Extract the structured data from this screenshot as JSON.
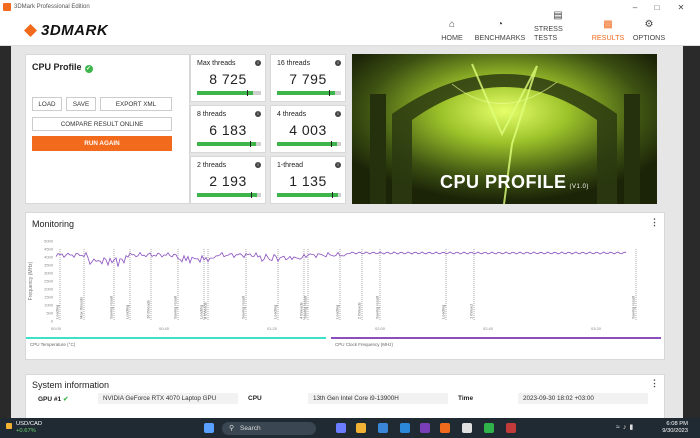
{
  "window": {
    "title": "3DMark Professional Edition"
  },
  "header": {
    "brand": "3DMARK",
    "nav": [
      {
        "label": "HOME",
        "icon": "home-icon"
      },
      {
        "label": "BENCHMARKS",
        "icon": "benchmarks-icon"
      },
      {
        "label": "STRESS TESTS",
        "icon": "stress-tests-icon"
      },
      {
        "label": "RESULTS",
        "icon": "results-icon",
        "active": true
      },
      {
        "label": "OPTIONS",
        "icon": "gear-icon"
      }
    ]
  },
  "profile": {
    "title": "CPU Profile",
    "load": "LOAD",
    "save": "SAVE",
    "export": "EXPORT XML",
    "compare": "COMPARE RESULT ONLINE",
    "run_again": "RUN AGAIN"
  },
  "scores": [
    {
      "label": "Max threads",
      "value": "8 725",
      "level": 0.88
    },
    {
      "label": "16 threads",
      "value": "7 795",
      "level": 0.9
    },
    {
      "label": "8 threads",
      "value": "6 183",
      "level": 0.92
    },
    {
      "label": "4 threads",
      "value": "4 003",
      "level": 0.93
    },
    {
      "label": "2 threads",
      "value": "2 193",
      "level": 0.94
    },
    {
      "label": "1-thread",
      "value": "1 135",
      "level": 0.95
    }
  ],
  "banner": {
    "title": "CPU PROFILE",
    "version": "(V1.0)"
  },
  "monitoring": {
    "title": "Monitoring",
    "ylabel": "Frequency (MHz)",
    "yticks": [
      "5000",
      "4500",
      "4000",
      "3500",
      "3000",
      "2500",
      "2000",
      "1500",
      "1000",
      "500",
      "0"
    ],
    "xticks": [
      "00:00",
      "00:40",
      "01:20",
      "02:00",
      "02:40",
      "03:20"
    ],
    "markers": [
      "Loading",
      "Max threads",
      "Saving result",
      "Loading",
      "16 threads",
      "Saving result",
      "Loading",
      "8 threads",
      "Saving result",
      "Loading",
      "4 threads",
      "Saving result",
      "Loading",
      "2 threads",
      "Saving result",
      "Loading",
      "1 thread",
      "Saving result"
    ],
    "legend": [
      {
        "label": "CPU Temperature (°C)",
        "color": "#3de0c8"
      },
      {
        "label": "CPU Clock Frequency (MHz)",
        "color": "#8a4fbf"
      }
    ],
    "series_color": "#8a4fbf"
  },
  "sysinfo": {
    "title": "System information",
    "gpu_label": "GPU #1",
    "gpu_value": "NVIDIA GeForce RTX 4070 Laptop GPU",
    "cpu_label": "CPU",
    "cpu_value": "13th Gen Intel Core i9-13900H",
    "time_label": "Time",
    "time_value": "2023-09-30 18:02 +03:00"
  },
  "taskbar": {
    "stock_name": "USD/CAD",
    "stock_change": "+0.67%",
    "search": "Search",
    "time": "6:08 PM",
    "date": "9/30/2023"
  },
  "colors": {
    "accent": "#f26a1b",
    "success": "#3db54a"
  }
}
